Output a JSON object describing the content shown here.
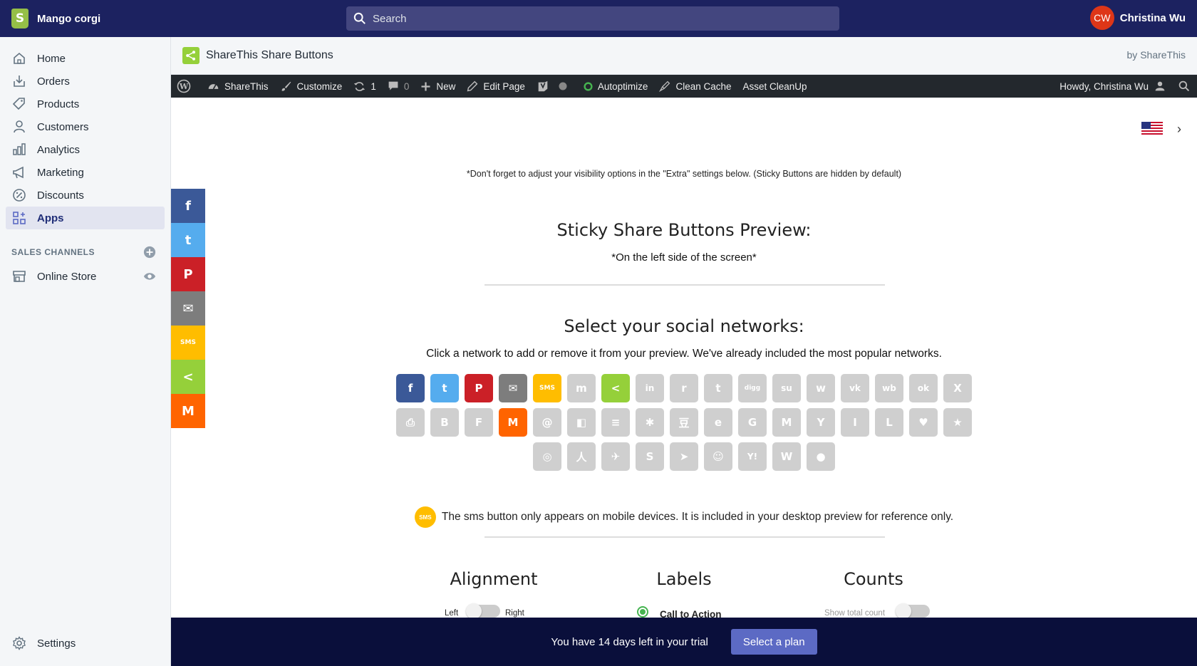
{
  "topbar": {
    "store_name": "Mango corgi",
    "search_placeholder": "Search",
    "user_initials": "CW",
    "user_name": "Christina Wu"
  },
  "sidebar": {
    "items": [
      {
        "label": "Home",
        "icon": "home-icon"
      },
      {
        "label": "Orders",
        "icon": "orders-icon"
      },
      {
        "label": "Products",
        "icon": "tag-icon"
      },
      {
        "label": "Customers",
        "icon": "person-icon"
      },
      {
        "label": "Analytics",
        "icon": "bar-chart-icon"
      },
      {
        "label": "Marketing",
        "icon": "megaphone-icon"
      },
      {
        "label": "Discounts",
        "icon": "discount-icon"
      },
      {
        "label": "Apps",
        "icon": "apps-icon",
        "active": true
      }
    ],
    "sales_channels_label": "SALES CHANNELS",
    "online_store": "Online Store",
    "settings": "Settings"
  },
  "app": {
    "title": "ShareThis Share Buttons",
    "by": "by ShareThis"
  },
  "wpbar": {
    "sharethis": "ShareThis",
    "customize": "Customize",
    "updates": "1",
    "comments": "0",
    "new": "New",
    "edit_page": "Edit Page",
    "autoptimize": "Autoptimize",
    "clean_cache": "Clean Cache",
    "asset_cleanup": "Asset CleanUp",
    "howdy": "Howdy, Christina Wu"
  },
  "content": {
    "note": "*Don't forget to adjust your visibility options in the \"Extra\" settings below. (Sticky Buttons are hidden by default)",
    "preview_title": "Sticky Share Buttons Preview:",
    "preview_sub": "*On the left side of the screen*",
    "select_title": "Select your social networks:",
    "select_sub": "Click a network to add or remove it from your preview. We've already included the most popular networks.",
    "sms_note": "The sms button only appears on mobile devices. It is included in your desktop preview for reference only.",
    "sms_label": "SMS",
    "alignment": "Alignment",
    "labels": "Labels",
    "counts": "Counts",
    "left": "Left",
    "right": "Right",
    "call_to_action": "Call to Action",
    "show_total_count": "Show total count"
  },
  "networks": {
    "row1": [
      {
        "name": "facebook",
        "glyph": "f",
        "color": "#3b5998"
      },
      {
        "name": "twitter",
        "glyph": "t",
        "color": "#55acee"
      },
      {
        "name": "pinterest",
        "glyph": "P",
        "color": "#cb2027"
      },
      {
        "name": "email",
        "glyph": "✉",
        "color": "#7d7d7d"
      },
      {
        "name": "sms",
        "glyph": "SMS",
        "color": "#ffbd00"
      },
      {
        "name": "messenger",
        "glyph": "m",
        "color": "#cfcfcf"
      },
      {
        "name": "sharethis",
        "glyph": "<",
        "color": "#95d03a"
      },
      {
        "name": "linkedin",
        "glyph": "in",
        "color": "#cfcfcf"
      },
      {
        "name": "reddit",
        "glyph": "r",
        "color": "#cfcfcf"
      },
      {
        "name": "tumblr",
        "glyph": "t",
        "color": "#cfcfcf"
      },
      {
        "name": "digg",
        "glyph": "digg",
        "color": "#cfcfcf"
      },
      {
        "name": "stumbleupon",
        "glyph": "su",
        "color": "#cfcfcf"
      },
      {
        "name": "whatsapp",
        "glyph": "w",
        "color": "#cfcfcf"
      },
      {
        "name": "vk",
        "glyph": "vk",
        "color": "#cfcfcf"
      },
      {
        "name": "weibo",
        "glyph": "wb",
        "color": "#cfcfcf"
      },
      {
        "name": "odnoklassniki",
        "glyph": "ok",
        "color": "#cfcfcf"
      },
      {
        "name": "xing",
        "glyph": "X",
        "color": "#cfcfcf"
      }
    ],
    "row2": [
      {
        "name": "print",
        "glyph": "⎙",
        "color": "#cfcfcf"
      },
      {
        "name": "blogger",
        "glyph": "B",
        "color": "#cfcfcf"
      },
      {
        "name": "flipboard",
        "glyph": "F",
        "color": "#cfcfcf"
      },
      {
        "name": "meneame",
        "glyph": "M",
        "color": "#ff6400"
      },
      {
        "name": "mailru",
        "glyph": "@",
        "color": "#cfcfcf"
      },
      {
        "name": "delicious",
        "glyph": "◧",
        "color": "#cfcfcf"
      },
      {
        "name": "buffer",
        "glyph": "≡",
        "color": "#cfcfcf"
      },
      {
        "name": "livejournal",
        "glyph": "✱",
        "color": "#cfcfcf"
      },
      {
        "name": "douban",
        "glyph": "豆",
        "color": "#cfcfcf"
      },
      {
        "name": "evernote",
        "glyph": "e",
        "color": "#cfcfcf"
      },
      {
        "name": "google",
        "glyph": "G",
        "color": "#cfcfcf"
      },
      {
        "name": "gmail",
        "glyph": "M",
        "color": "#cfcfcf"
      },
      {
        "name": "yahoo-mail",
        "glyph": "Y",
        "color": "#cfcfcf"
      },
      {
        "name": "instapaper",
        "glyph": "I",
        "color": "#cfcfcf"
      },
      {
        "name": "line",
        "glyph": "L",
        "color": "#cfcfcf"
      },
      {
        "name": "pocket",
        "glyph": "♥",
        "color": "#cfcfcf"
      },
      {
        "name": "qzone",
        "glyph": "★",
        "color": "#cfcfcf"
      }
    ],
    "row3": [
      {
        "name": "refind",
        "glyph": "◎",
        "color": "#cfcfcf"
      },
      {
        "name": "renren",
        "glyph": "人",
        "color": "#cfcfcf"
      },
      {
        "name": "sinaweibo-bird",
        "glyph": "✈",
        "color": "#cfcfcf"
      },
      {
        "name": "skype",
        "glyph": "S",
        "color": "#cfcfcf"
      },
      {
        "name": "telegram",
        "glyph": "➤",
        "color": "#cfcfcf"
      },
      {
        "name": "vk-contact",
        "glyph": "☺",
        "color": "#cfcfcf"
      },
      {
        "name": "yahoo",
        "glyph": "Y!",
        "color": "#cfcfcf"
      },
      {
        "name": "wordpress",
        "glyph": "W",
        "color": "#cfcfcf"
      },
      {
        "name": "wechat",
        "glyph": "●",
        "color": "#cfcfcf"
      }
    ]
  },
  "sticky": [
    {
      "name": "facebook",
      "glyph": "f",
      "color": "#3b5998"
    },
    {
      "name": "twitter",
      "glyph": "t",
      "color": "#55acee"
    },
    {
      "name": "pinterest",
      "glyph": "P",
      "color": "#cb2027"
    },
    {
      "name": "email",
      "glyph": "✉",
      "color": "#7d7d7d"
    },
    {
      "name": "sms",
      "glyph": "SMS",
      "color": "#ffbd00"
    },
    {
      "name": "sharethis",
      "glyph": "<",
      "color": "#95d03a"
    },
    {
      "name": "meneame",
      "glyph": "M",
      "color": "#ff6400"
    }
  ],
  "trial": {
    "text": "You have 14 days left in your trial",
    "button": "Select a plan"
  }
}
